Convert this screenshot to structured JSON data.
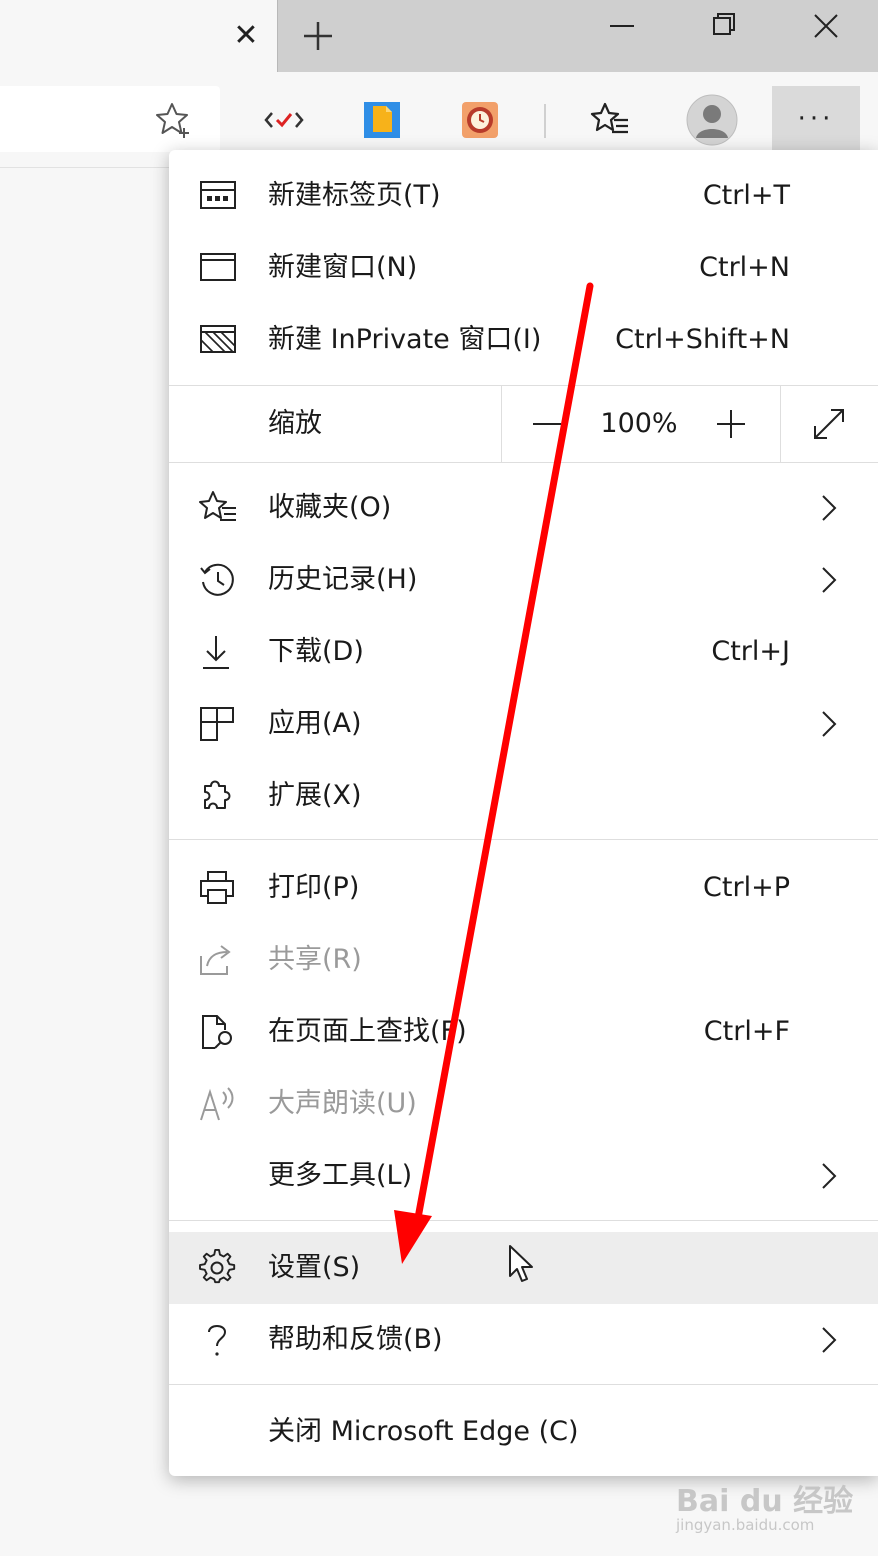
{
  "window": {
    "tab_close_glyph": "✕",
    "controls": [
      "minimize-icon",
      "restore-icon",
      "close-icon"
    ]
  },
  "toolbar": {
    "more_label": "···",
    "extensions": [
      "code-extension-icon",
      "document-extension-icon",
      "clock-extension-icon"
    ]
  },
  "menu": {
    "new_tab": {
      "label": "新建标签页(T)",
      "shortcut": "Ctrl+T"
    },
    "new_window": {
      "label": "新建窗口(N)",
      "shortcut": "Ctrl+N"
    },
    "new_inprivate": {
      "label": "新建 InPrivate 窗口(I)",
      "shortcut": "Ctrl+Shift+N"
    },
    "zoom": {
      "label": "缩放",
      "value": "100%"
    },
    "favorites": {
      "label": "收藏夹(O)"
    },
    "history": {
      "label": "历史记录(H)"
    },
    "downloads": {
      "label": "下载(D)",
      "shortcut": "Ctrl+J"
    },
    "apps": {
      "label": "应用(A)"
    },
    "extensions": {
      "label": "扩展(X)"
    },
    "print": {
      "label": "打印(P)",
      "shortcut": "Ctrl+P"
    },
    "share": {
      "label": "共享(R)"
    },
    "find": {
      "label": "在页面上查找(F)",
      "shortcut": "Ctrl+F"
    },
    "read_aloud": {
      "label": "大声朗读(U)"
    },
    "more_tools": {
      "label": "更多工具(L)"
    },
    "settings": {
      "label": "设置(S)"
    },
    "help": {
      "label": "帮助和反馈(B)"
    },
    "close_edge": {
      "label": "关闭 Microsoft Edge (C)"
    }
  },
  "annotation": {
    "arrow_color": "#ff0000"
  },
  "watermark": {
    "main": "Bai du 经验",
    "sub": "jingyan.baidu.com"
  }
}
